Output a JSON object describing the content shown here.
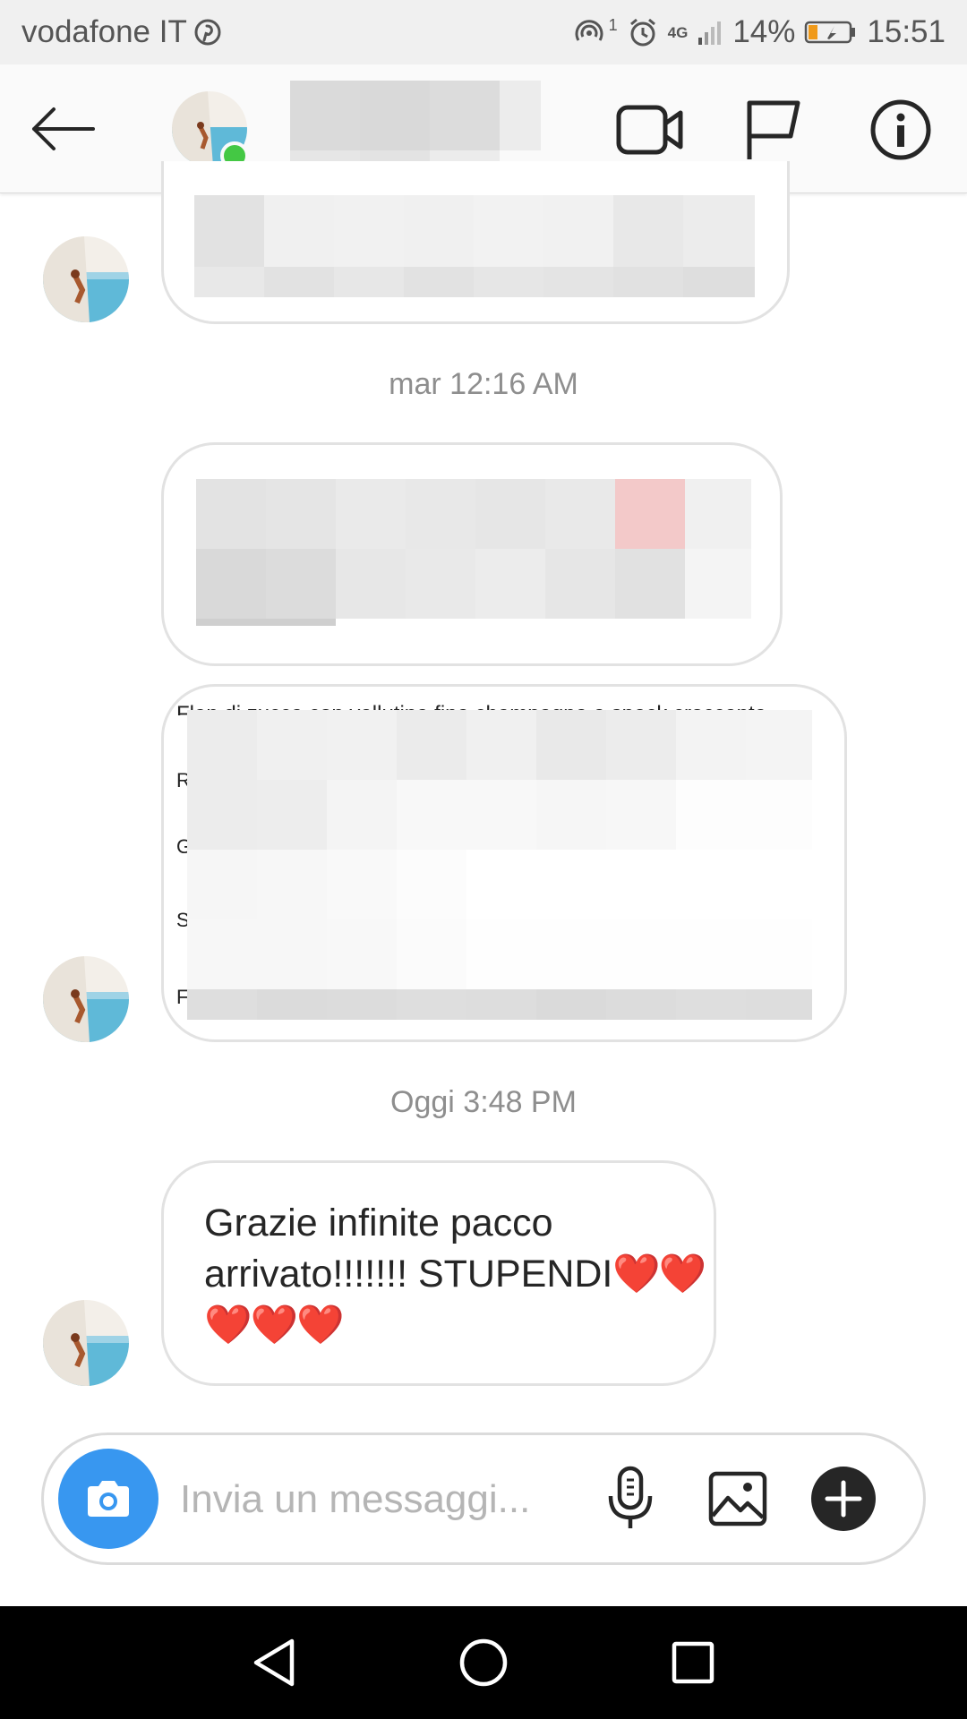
{
  "status_bar": {
    "carrier": "vodafone IT",
    "battery": "14%",
    "time": "15:51",
    "network": "4G",
    "notification_count": "1"
  },
  "header": {
    "icons": [
      "back-arrow-icon",
      "video-call-icon",
      "flag-icon",
      "info-icon"
    ]
  },
  "thread": {
    "timestamps": [
      "mar 12:16 AM",
      "Oggi 3:48 PM"
    ],
    "partial_message": {
      "first_line": "Flan di zucca con vellutina fine champagne e speck croccante",
      "line_initials": [
        "R",
        "G",
        "S",
        "F"
      ]
    },
    "last_message": {
      "text": "Grazie infinite pacco arrivato!!!!!!! STUPENDI",
      "hearts": "❤️❤️❤️❤️❤️"
    }
  },
  "composer": {
    "placeholder": "Invia un messaggi..."
  },
  "colors": {
    "accent": "#3897f0",
    "online": "#44c844",
    "bubble_border": "#e2e2e2",
    "timestamp": "#8e8e8e",
    "hearts": "#e0262e"
  }
}
